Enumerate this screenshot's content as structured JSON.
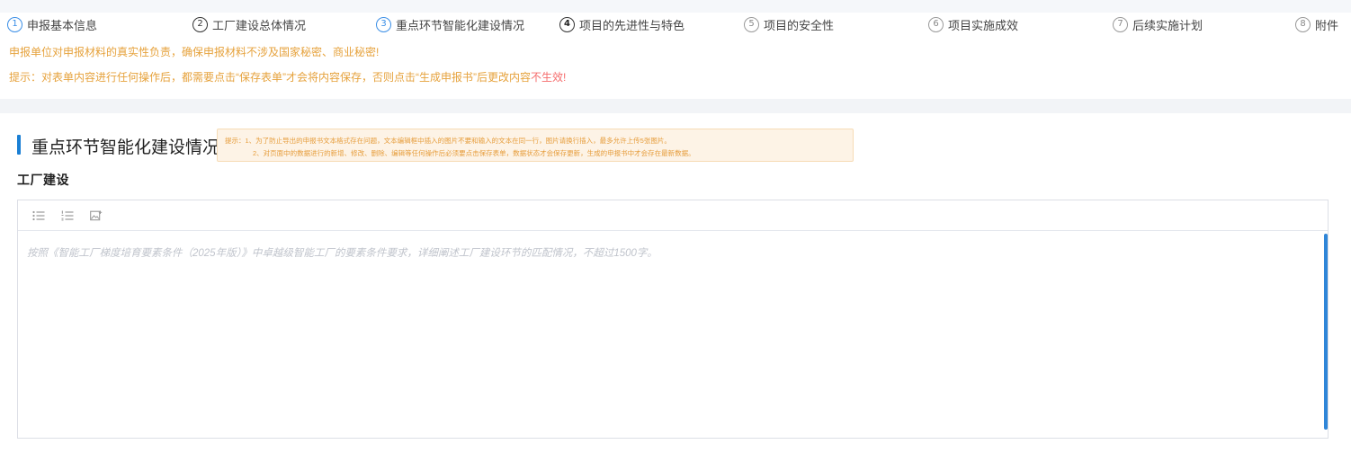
{
  "steps": [
    {
      "num": "1",
      "label": "申报基本信息"
    },
    {
      "num": "2",
      "label": "工厂建设总体情况"
    },
    {
      "num": "3",
      "label": "重点环节智能化建设情况"
    },
    {
      "num": "4",
      "label": "项目的先进性与特色"
    },
    {
      "num": "5",
      "label": "项目的安全性"
    },
    {
      "num": "6",
      "label": "项目实施成效"
    },
    {
      "num": "7",
      "label": "后续实施计划"
    },
    {
      "num": "8",
      "label": "附件"
    }
  ],
  "notices": {
    "line1": "申报单位对申报材料的真实性负责，确保申报材料不涉及国家秘密、商业秘密!",
    "line2_prefix": "提示：对表单内容进行任何操作后，都需要点击“保存表单”才会将内容保存，否则点击“生成申报书”后更改内容",
    "line2_red": "不生效!"
  },
  "section": {
    "title": "重点环节智能化建设情况",
    "tip_line1": "提示：1、为了防止导出的申报书文本格式存在问题，文本编辑框中插入的图片不要和输入的文本在同一行，图片请换行插入，最多允许上传5张图片。",
    "tip_line2": "2、对页面中的数据进行的新增、修改、删除、编辑等任何操作后必须要点击保存表单，数据状态才会保存更新，生成的申报书中才会存在最新数据。"
  },
  "subsection": {
    "title": "工厂建设"
  },
  "editor": {
    "placeholder": "按照《智能工厂梯度培育要素条件（2025年版）》中卓越级智能工厂的要素条件要求，详细阐述工厂建设环节的匹配情况，不超过1500字。"
  },
  "icons": [
    "bullet-list-icon",
    "ordered-list-icon",
    "image-insert-icon"
  ],
  "colors": {
    "accent": "#1a7fd4",
    "warning": "#e6a23c",
    "danger": "#f56c6c"
  }
}
